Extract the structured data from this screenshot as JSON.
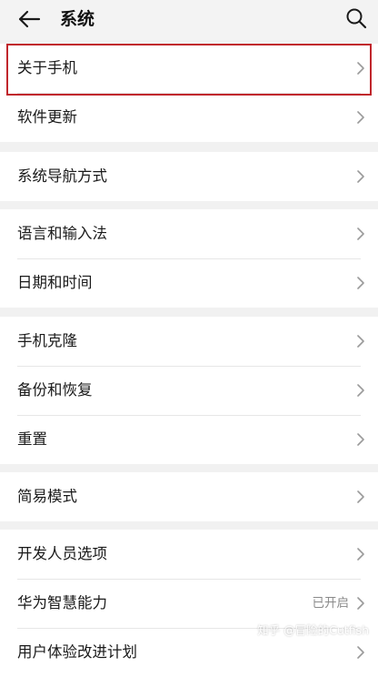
{
  "header": {
    "title": "系统",
    "back_icon": "arrow-left-icon",
    "search_icon": "search-icon"
  },
  "groups": [
    {
      "items": [
        {
          "label": "关于手机",
          "value": ""
        },
        {
          "label": "软件更新",
          "value": ""
        }
      ]
    },
    {
      "items": [
        {
          "label": "系统导航方式",
          "value": ""
        }
      ]
    },
    {
      "items": [
        {
          "label": "语言和输入法",
          "value": ""
        },
        {
          "label": "日期和时间",
          "value": ""
        }
      ]
    },
    {
      "items": [
        {
          "label": "手机克隆",
          "value": ""
        },
        {
          "label": "备份和恢复",
          "value": ""
        },
        {
          "label": "重置",
          "value": ""
        }
      ]
    },
    {
      "items": [
        {
          "label": "简易模式",
          "value": ""
        }
      ]
    },
    {
      "items": [
        {
          "label": "开发人员选项",
          "value": ""
        },
        {
          "label": "华为智慧能力",
          "value": "已开启"
        },
        {
          "label": "用户体验改进计划",
          "value": ""
        }
      ]
    }
  ],
  "watermark": "知乎 @冒险的Cutfish",
  "colors": {
    "highlight": "#c0262c",
    "background": "#f1f1f1",
    "card": "#ffffff"
  }
}
